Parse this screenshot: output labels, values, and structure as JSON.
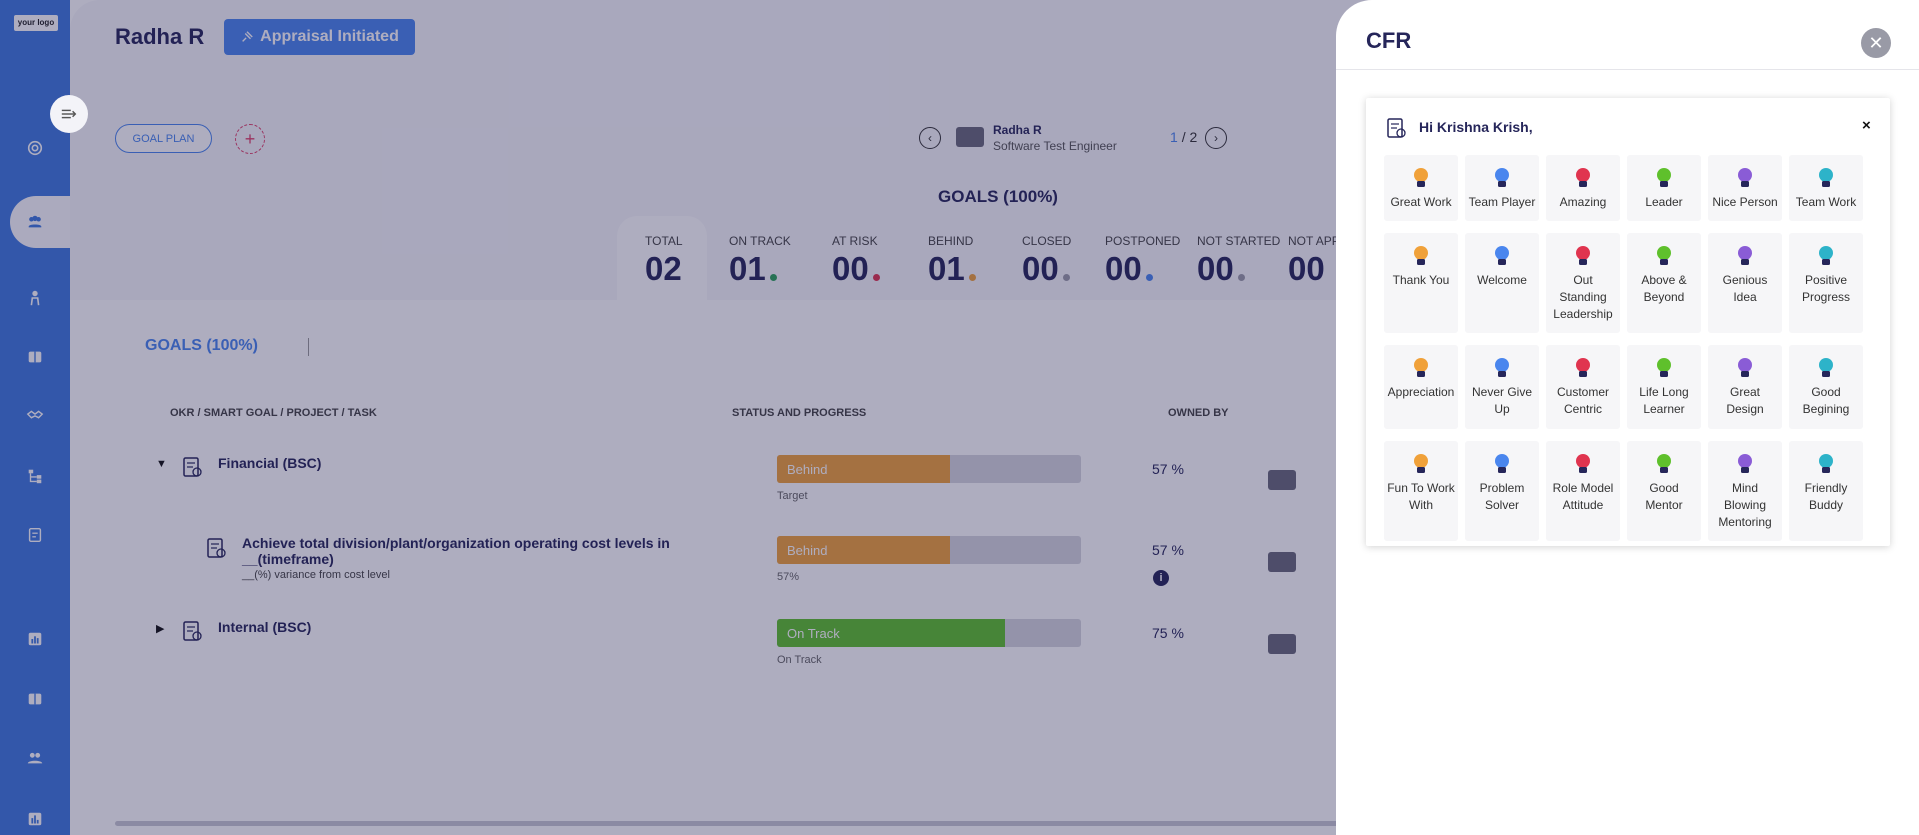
{
  "sidebar": {
    "logo": "your logo"
  },
  "header": {
    "user_name": "Radha R",
    "appraisal_label": "Appraisal Initiated",
    "goal_plan_label": "GOAL PLAN",
    "add_label": "+"
  },
  "pager": {
    "employee_name": "Radha R",
    "employee_role": "Software Test Engineer",
    "current": "1",
    "separator": "/",
    "total": "2"
  },
  "summary": {
    "title": "GOALS (100%)",
    "stats": [
      {
        "label": "TOTAL",
        "value": "02",
        "dot": ""
      },
      {
        "label": "ON TRACK",
        "value": "01",
        "dot": "#2da35a"
      },
      {
        "label": "AT RISK",
        "value": "00",
        "dot": "#e0344f"
      },
      {
        "label": "BEHIND",
        "value": "01",
        "dot": "#f0a13a"
      },
      {
        "label": "CLOSED",
        "value": "00",
        "dot": "#9c9ca8"
      },
      {
        "label": "POSTPONED",
        "value": "00",
        "dot": "#4a86ee"
      },
      {
        "label": "NOT STARTED",
        "value": "00",
        "dot": "#9c9ca8"
      },
      {
        "label": "NOT APP",
        "value": "00",
        "dot": ""
      }
    ]
  },
  "goals_table": {
    "heading": "GOALS (100%)",
    "columns": [
      "OKR / SMART GOAL / PROJECT / TASK",
      "STATUS AND PROGRESS",
      "OWNED BY"
    ],
    "rows": [
      {
        "caret": "▼",
        "name": "Financial (BSC)",
        "sub": "",
        "status": "Behind",
        "status_color": "#f0a13a",
        "progress": 0.57,
        "bar_sub": "Target",
        "pct": "57 %"
      },
      {
        "caret": "",
        "name": "Achieve total division/plant/organization operating cost levels in __(timeframe)",
        "sub": "__(%) variance from cost level",
        "status": "Behind",
        "status_color": "#f0a13a",
        "progress": 0.57,
        "bar_sub": "57%",
        "pct": "57 %"
      },
      {
        "caret": "▶",
        "name": "Internal (BSC)",
        "sub": "",
        "status": "On Track",
        "status_color": "#5fc02c",
        "progress": 0.75,
        "bar_sub": "On Track",
        "pct": "75 %"
      }
    ]
  },
  "cfr": {
    "title": "CFR",
    "close": "✕",
    "greeting": "Hi Krishna Krish,",
    "card_close": "×",
    "badges": [
      {
        "label": "Great Work",
        "icon": "medal-icon"
      },
      {
        "label": "Team Player",
        "icon": "team-player-icon"
      },
      {
        "label": "Amazing",
        "icon": "amazing-face-icon"
      },
      {
        "label": "Leader",
        "icon": "leader-icon"
      },
      {
        "label": "Nice Person",
        "icon": "thumbs-up-icon"
      },
      {
        "label": "Team Work",
        "icon": "team-hands-icon"
      },
      {
        "label": "Thank You",
        "icon": "thank-you-icon"
      },
      {
        "label": "Welcome",
        "icon": "welcome-hands-icon"
      },
      {
        "label": "Out Standing Leadership",
        "icon": "gauge-icon"
      },
      {
        "label": "Above & Beyond",
        "icon": "growth-chart-icon"
      },
      {
        "label": "Genious Idea",
        "icon": "idea-bulb-icon"
      },
      {
        "label": "Positive Progress",
        "icon": "gear-progress-icon"
      },
      {
        "label": "Appreciation",
        "icon": "clap-icon"
      },
      {
        "label": "Never Give Up",
        "icon": "raised-hand-icon"
      },
      {
        "label": "Customer Centric",
        "icon": "customer-icon"
      },
      {
        "label": "Life Long Learner",
        "icon": "book-icon"
      },
      {
        "label": "Great Design",
        "icon": "design-pen-icon"
      },
      {
        "label": "Good Begining",
        "icon": "bulb-icon"
      },
      {
        "label": "Fun To Work With",
        "icon": "fun-icon"
      },
      {
        "label": "Problem Solver",
        "icon": "problem-solver-icon"
      },
      {
        "label": "Role Model Attitude",
        "icon": "role-model-icon"
      },
      {
        "label": "Good Mentor",
        "icon": "mentor-icon"
      },
      {
        "label": "Mind Blowing Mentoring",
        "icon": "mind-blowing-icon"
      },
      {
        "label": "Friendly Buddy",
        "icon": "buddy-house-icon"
      }
    ]
  }
}
